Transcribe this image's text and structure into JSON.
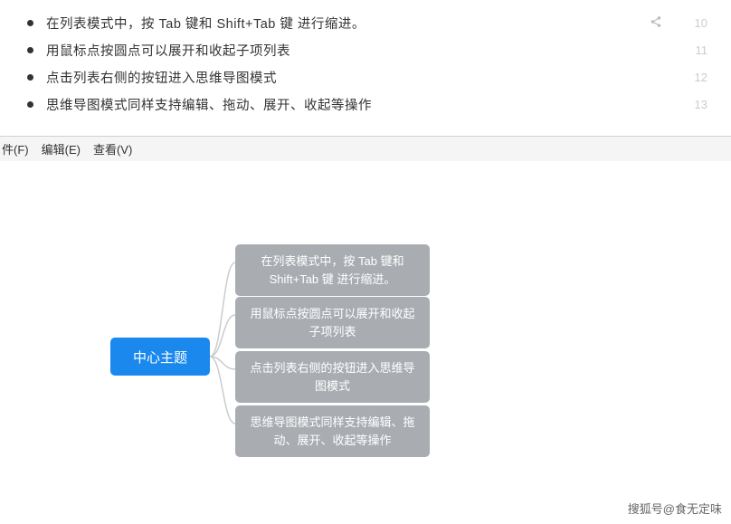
{
  "list": {
    "items": [
      {
        "text": "在列表模式中，按 Tab 键和 Shift+Tab 键 进行缩进。",
        "num": "10",
        "share": true
      },
      {
        "text": "用鼠标点按圆点可以展开和收起子项列表",
        "num": "11",
        "share": false
      },
      {
        "text": "点击列表右侧的按钮进入思维导图模式",
        "num": "12",
        "share": false
      },
      {
        "text": "思维导图模式同样支持编辑、拖动、展开、收起等操作",
        "num": "13",
        "share": false
      }
    ]
  },
  "menubar": {
    "file": "件(F)",
    "edit": "编辑(E)",
    "view": "查看(V)"
  },
  "mindmap": {
    "center": "中心主题",
    "children": [
      "在列表模式中，按 Tab 键和 Shift+Tab 键 进行缩进。",
      "用鼠标点按圆点可以展开和收起子项列表",
      "点击列表右侧的按钮进入思维导图模式",
      "思维导图模式同样支持编辑、拖动、展开、收起等操作"
    ]
  },
  "watermark": "搜狐号@食无定味"
}
